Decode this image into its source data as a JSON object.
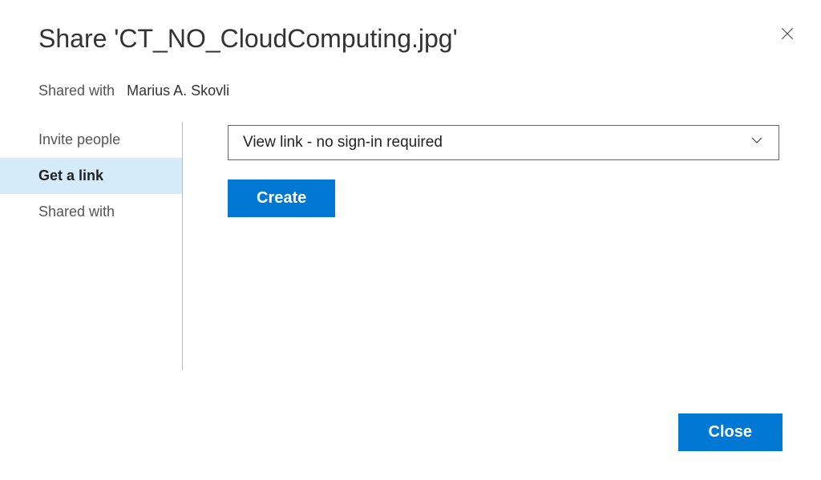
{
  "title": "Share 'CT_NO_CloudComputing.jpg'",
  "shared_with_label": "Shared with",
  "shared_with_name": "Marius A. Skovli",
  "sidebar": {
    "items": [
      {
        "label": "Invite people"
      },
      {
        "label": "Get a link"
      },
      {
        "label": "Shared with"
      }
    ]
  },
  "dropdown": {
    "selected": "View link - no sign-in required"
  },
  "buttons": {
    "create": "Create",
    "close": "Close"
  }
}
